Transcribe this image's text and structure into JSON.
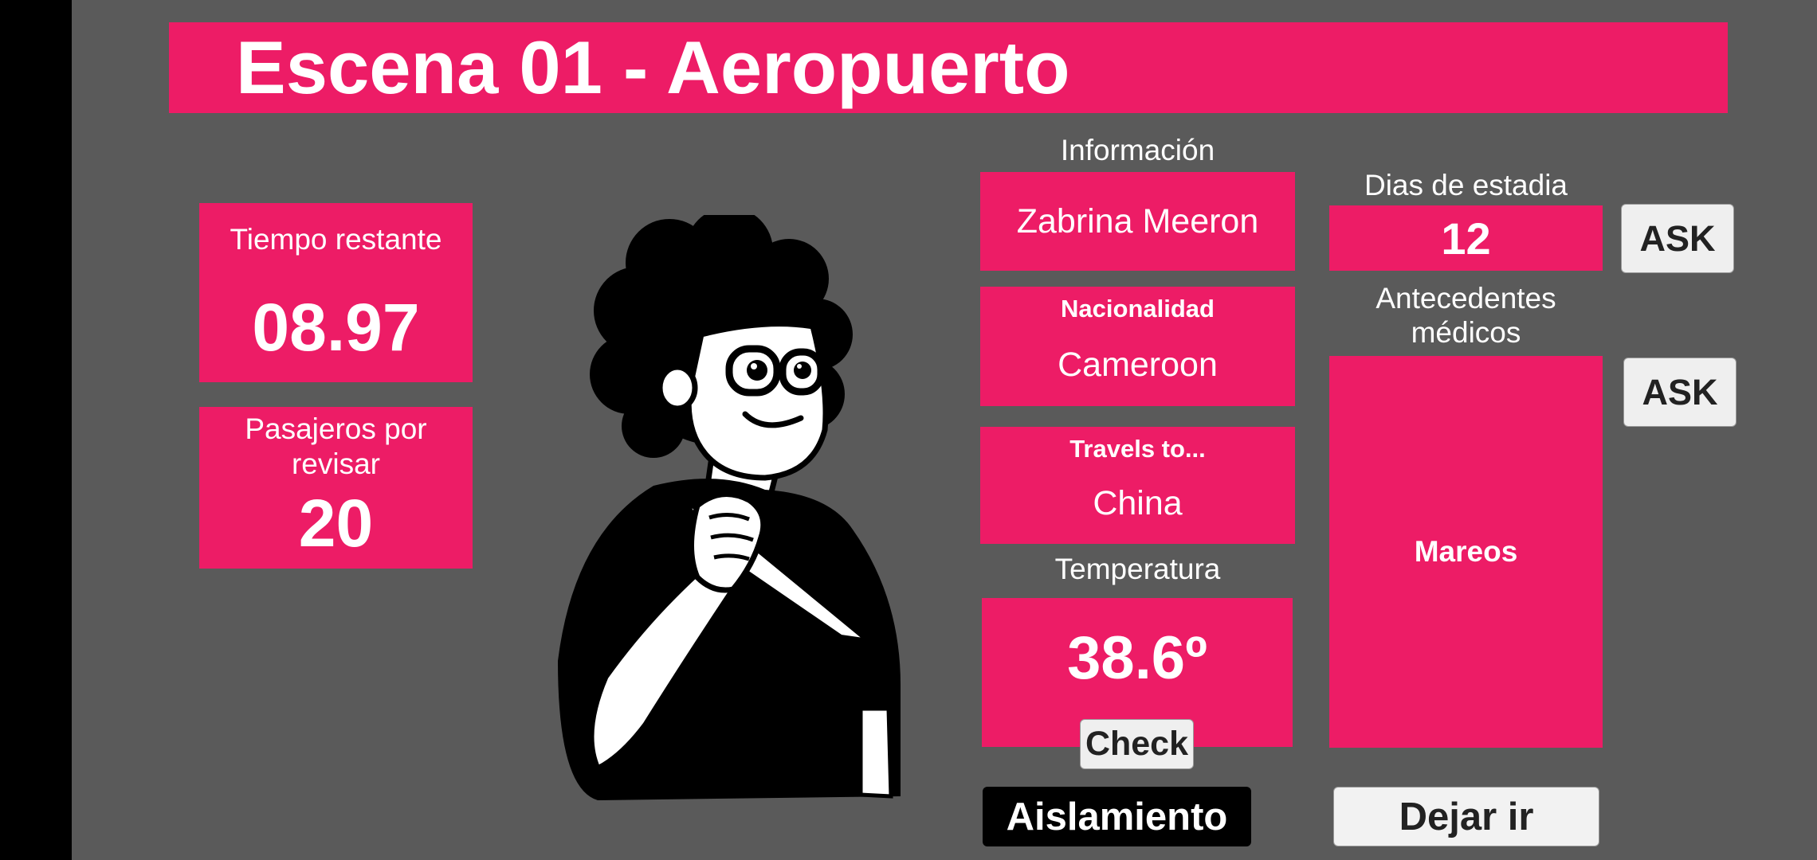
{
  "scene": {
    "title": "Escena 01 - Aeropuerto"
  },
  "timer": {
    "label": "Tiempo restante",
    "value": "08.97"
  },
  "passengers": {
    "label": "Pasajeros por revisar",
    "value": "20"
  },
  "info": {
    "heading": "Información",
    "name": "Zabrina Meeron",
    "nationality_label": "Nacionalidad",
    "nationality": "Cameroon",
    "travels_label": "Travels to...",
    "travels": "China"
  },
  "temperature": {
    "label": "Temperatura",
    "value": "38.6º",
    "check_label": "Check"
  },
  "stay": {
    "label": "Dias de estadia",
    "value": "12",
    "ask_label": "ASK"
  },
  "medical": {
    "label": "Antecedentes médicos",
    "value": "Mareos",
    "ask_label": "ASK"
  },
  "actions": {
    "isolate_label": "Aislamiento",
    "release_label": "Dejar ir"
  },
  "colors": {
    "accent": "#ed1c66",
    "background": "#5a5a5a",
    "sidebar": "#000000"
  },
  "icons": {
    "character": "passenger-character-illustration"
  }
}
